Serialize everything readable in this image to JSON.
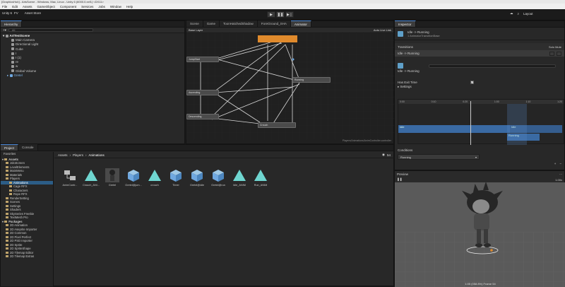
{
  "window": {
    "title": "[GraphicsHub] - ArtsScene - Windows, Mac, Linux - Unity 6 (6000.0.xxf1) <DX11>"
  },
  "menu": [
    "File",
    "Edit",
    "Assets",
    "GameObject",
    "Component",
    "Services",
    "Jobs",
    "Window",
    "Help"
  ],
  "toolbar": {
    "account": "Unity 6",
    "version": "FV",
    "asset_store": "Asset Store",
    "layout": "Layout"
  },
  "hierarchy": {
    "tab": "Hierarchy",
    "search_placeholder": "All",
    "scene": "ArtTestScene",
    "items": [
      "Main Camera",
      "Directional Light",
      "Cube",
      "I",
      "I (1)",
      "re",
      "w",
      "Global Volume",
      "Gretel"
    ]
  },
  "scene_tabs": [
    "Scene",
    "Game",
    "ToonHatchedShadow",
    "ForeGround_SHA",
    "Animator"
  ],
  "animator": {
    "layer": "Base Layer",
    "auto_live": "Auto Live Link",
    "nodes": [
      "JumpStart",
      "Ascending",
      "Descending",
      "Running",
      "Crouch"
    ],
    "footer": "Players/Animations/AnimController.controller"
  },
  "project": {
    "tabs": [
      "Project",
      "Console"
    ],
    "tree_favs": "Favorites",
    "assets_label": "Assets",
    "tree": [
      {
        "label": "JoloScreen",
        "sel": false,
        "indent": 1
      },
      {
        "label": "LevelElements",
        "sel": false,
        "indent": 1
      },
      {
        "label": "MainMenu",
        "sel": false,
        "indent": 1
      },
      {
        "label": "Materials",
        "sel": false,
        "indent": 1
      },
      {
        "label": "Players",
        "sel": false,
        "indent": 1
      },
      {
        "label": "Animations",
        "sel": true,
        "indent": 2
      },
      {
        "label": "Cage RFX",
        "sel": false,
        "indent": 2
      },
      {
        "label": "Characters",
        "sel": false,
        "indent": 2
      },
      {
        "label": "Rope RFX",
        "sel": false,
        "indent": 2
      },
      {
        "label": "RenderSetting",
        "sel": false,
        "indent": 1
      },
      {
        "label": "Scenes",
        "sel": false,
        "indent": 1
      },
      {
        "label": "Settings",
        "sel": false,
        "indent": 1
      },
      {
        "label": "Shaders",
        "sel": false,
        "indent": 1
      },
      {
        "label": "SkySeries Freebie",
        "sel": false,
        "indent": 1
      },
      {
        "label": "TextMesh Pro",
        "sel": false,
        "indent": 1
      }
    ],
    "packages_label": "Packages",
    "packages": [
      "2D Animation",
      "2D Aseprite Importer",
      "2D Common",
      "2D Pixel Perfect",
      "2D PSD Importer",
      "2D Sprite",
      "2D SpriteShape",
      "2D Tilemap Editor",
      "2D Tilemap Extras"
    ],
    "breadcrumb": [
      "Assets",
      "Players",
      "Animations"
    ],
    "count": "54",
    "assets": [
      {
        "name": "AnimContr...",
        "kind": "controller"
      },
      {
        "name": "Crouch_ANI...",
        "kind": "clip"
      },
      {
        "name": "Gretel",
        "kind": "model"
      },
      {
        "name": "Gretel@jum...",
        "kind": "box"
      },
      {
        "name": "crouch",
        "kind": "clip"
      },
      {
        "name": "Timer",
        "kind": "box"
      },
      {
        "name": "Gretel@idle",
        "kind": "box"
      },
      {
        "name": "Gretel@run",
        "kind": "box"
      },
      {
        "name": "Idle_ANIM",
        "kind": "clip"
      },
      {
        "name": "Run_ANIM",
        "kind": "clip"
      }
    ]
  },
  "inspector": {
    "tab": "Inspector",
    "title": "Idle -> Running",
    "subtitle": "1 AnimatorTransitionBase",
    "transitions_label": "Transitions",
    "solo": "Solo",
    "mute": "Mute",
    "transition_row": "Idle -> Running",
    "name_label": "Idle -> Running",
    "has_exit_label": "Has Exit Time",
    "settings_label": "Settings",
    "ticks": [
      "0:00",
      "0:10",
      "0:20",
      "1:00",
      "1:10",
      "1:20"
    ],
    "clip_a": "Idle",
    "clip_b": "Idle",
    "clip_c": "Running",
    "conditions_label": "Conditions",
    "condition": "Running",
    "preview_label": "Preview",
    "speed": "1.00x",
    "frame_info": "1:05 (058.8%) Frame 54"
  },
  "colors": {
    "accent": "#4a88d8",
    "select": "#2c5d87",
    "orange": "#e08a2c",
    "clip": "#3a6aa3"
  }
}
